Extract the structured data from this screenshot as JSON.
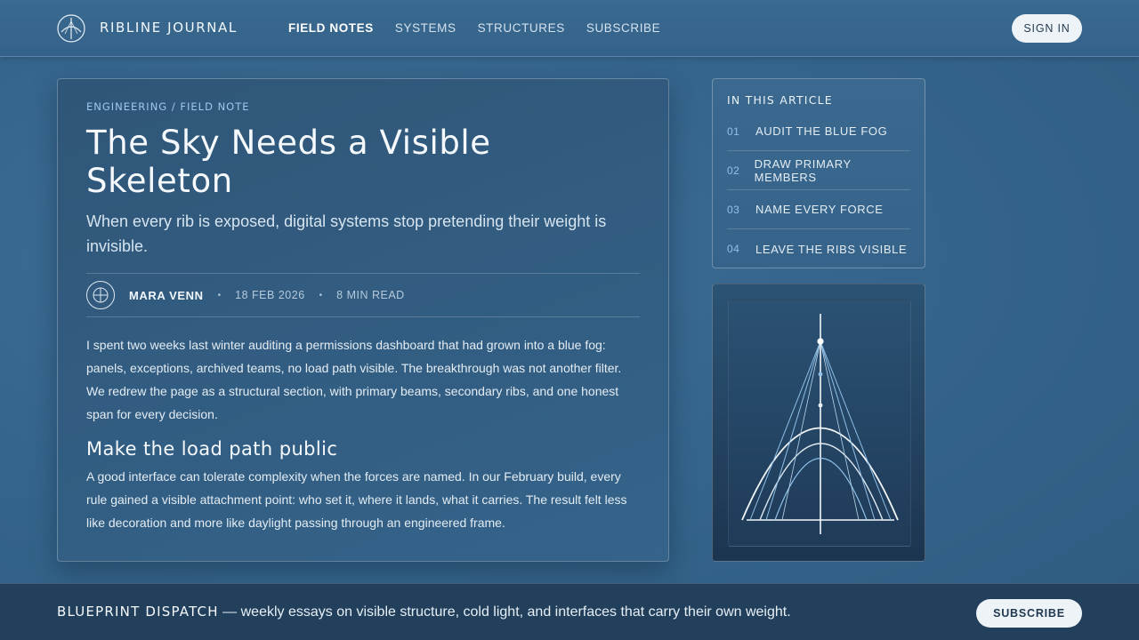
{
  "header": {
    "brand": "RIBLINE JOURNAL",
    "logo_icon": "rib-compass-icon",
    "nav": [
      {
        "label": "FIELD NOTES",
        "active": true
      },
      {
        "label": "SYSTEMS",
        "active": false
      },
      {
        "label": "STRUCTURES",
        "active": false
      },
      {
        "label": "SUBSCRIBE",
        "active": false
      }
    ],
    "sign_in_label": "SIGN IN"
  },
  "article": {
    "kicker": "ENGINEERING / FIELD NOTE",
    "title": "The Sky Needs a Visible Skeleton",
    "dek": "When every rib is exposed, digital systems stop pretending their weight is invisible.",
    "author": "MARA VENN",
    "date": "18 FEB 2026",
    "read_time": "8 MIN READ",
    "separator": "•",
    "paragraph_1": "I spent two weeks last winter auditing a permissions dashboard that had grown into a blue fog: panels, exceptions, archived teams, no load path visible. The breakthrough was not another filter. We redrew the page as a structural section, with primary beams, secondary ribs, and one honest span for every decision.",
    "subhead": "Make the load path public",
    "paragraph_2": "A good interface can tolerate complexity when the forces are named. In our February build, every rule gained a visible attachment point: who set it, where it lands, what it carries. The result felt less like decoration and more like daylight passing through an engineered frame."
  },
  "toc": {
    "title": "IN THIS ARTICLE",
    "items": [
      {
        "num": "01",
        "label": "AUDIT THE BLUE FOG"
      },
      {
        "num": "02",
        "label": "DRAW PRIMARY MEMBERS"
      },
      {
        "num": "03",
        "label": "NAME EVERY FORCE"
      },
      {
        "num": "04",
        "label": "LEAVE THE RIBS VISIBLE"
      }
    ]
  },
  "footer": {
    "brand": "BLUEPRINT DISPATCH",
    "text": " — weekly essays on visible structure, cold light, and interfaces that carry their own weight.",
    "subscribe_label": "SUBSCRIBE"
  },
  "colors": {
    "accent": "#8fc0e8",
    "background": "#35658c",
    "button_bg": "#eef3f7",
    "button_text": "#1f3850"
  }
}
